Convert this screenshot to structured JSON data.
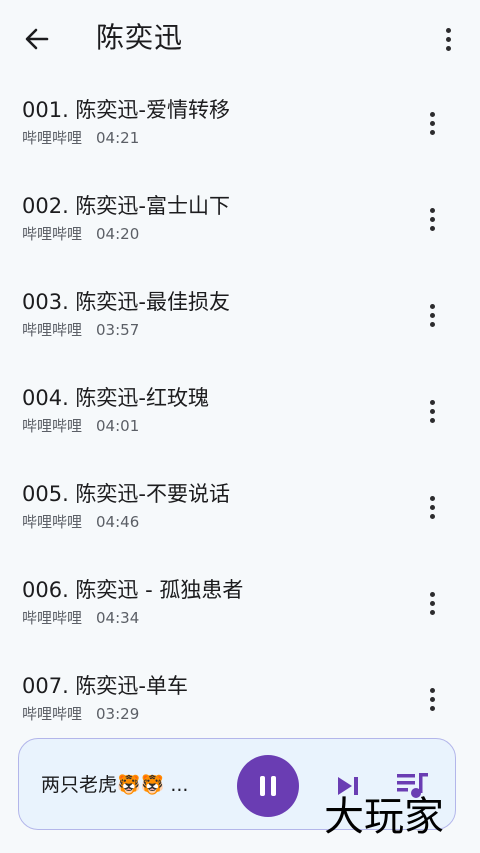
{
  "header": {
    "title": "陈奕迅",
    "back_icon": "arrow-left-icon",
    "more_icon": "more-vert-icon"
  },
  "songs": [
    {
      "title": "001. 陈奕迅-爱情转移",
      "source": "哔哩哔哩",
      "duration": "04:21"
    },
    {
      "title": "002. 陈奕迅-富士山下",
      "source": "哔哩哔哩",
      "duration": "04:20"
    },
    {
      "title": "003. 陈奕迅-最佳损友",
      "source": "哔哩哔哩",
      "duration": "03:57"
    },
    {
      "title": "004. 陈奕迅-红玫瑰",
      "source": "哔哩哔哩",
      "duration": "04:01"
    },
    {
      "title": "005. 陈奕迅-不要说话",
      "source": "哔哩哔哩",
      "duration": "04:46"
    },
    {
      "title": "006. 陈奕迅 - 孤独患者",
      "source": "哔哩哔哩",
      "duration": "04:34"
    },
    {
      "title": "007. 陈奕迅-单车",
      "source": "哔哩哔哩",
      "duration": "03:29"
    }
  ],
  "player": {
    "now_playing": "两只老虎🐯🐯 ...",
    "play_state": "playing",
    "icons": [
      "pause-icon",
      "skip-next-icon",
      "queue-music-icon"
    ],
    "accent_color": "#6a3db3"
  },
  "watermark": {
    "text": "大玩家"
  }
}
